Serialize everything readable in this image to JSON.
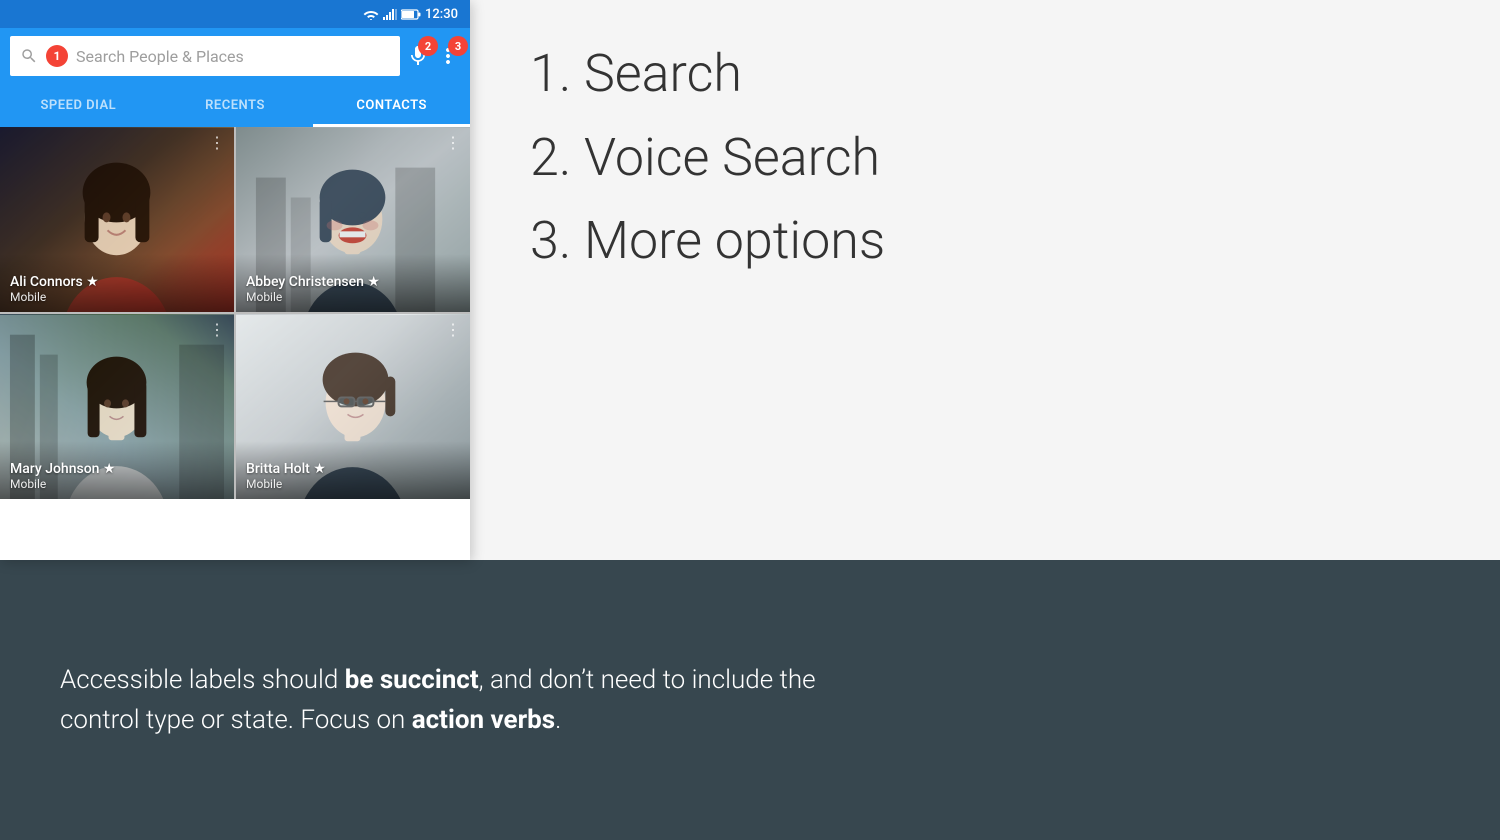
{
  "statusBar": {
    "time": "12:30"
  },
  "searchBar": {
    "placeholder": "Search People  &  Places",
    "badge1": "1",
    "badge2": "2",
    "badge3": "3"
  },
  "tabs": [
    {
      "id": "speed-dial",
      "label": "SPEED DIAL",
      "active": false
    },
    {
      "id": "recents",
      "label": "RECENTS",
      "active": false
    },
    {
      "id": "contacts",
      "label": "CONTACTS",
      "active": true
    }
  ],
  "contacts": [
    {
      "name": "Ali Connors ★",
      "type": "Mobile",
      "photo_class": "photo-ali"
    },
    {
      "name": "Abbey Christensen ★",
      "type": "Mobile",
      "photo_class": "photo-abbey"
    },
    {
      "name": "Mary Johnson ★",
      "type": "Mobile",
      "photo_class": "photo-mary"
    },
    {
      "name": "Britta Holt ★",
      "type": "Mobile",
      "photo_class": "photo-britta"
    }
  ],
  "instructions": [
    {
      "number": "1.",
      "label": "Search"
    },
    {
      "number": "2.",
      "label": "Voice Search"
    },
    {
      "number": "3.",
      "label": "More options"
    }
  ],
  "bottomText": {
    "part1": "Accessible labels should ",
    "bold1": "be succinct",
    "part2": ", and don’t need to include the control type or state. Focus on ",
    "bold2": "action verbs",
    "part3": "."
  }
}
